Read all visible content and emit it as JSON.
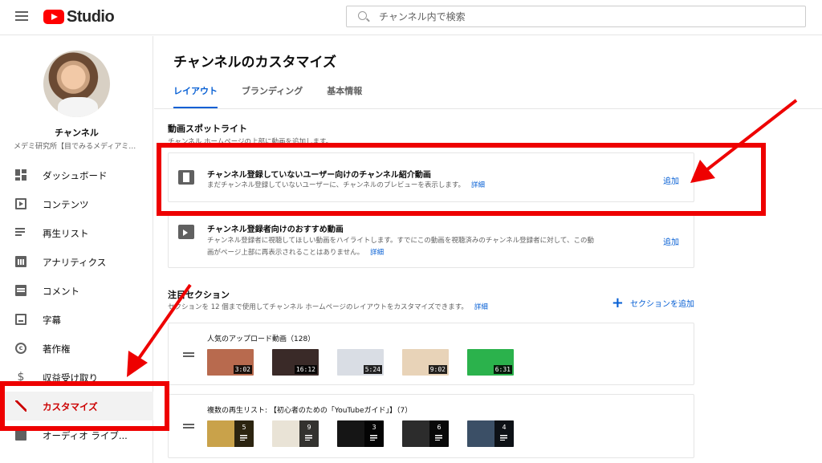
{
  "topbar": {
    "logo_text": "Studio",
    "search_placeholder": "チャンネル内で検索"
  },
  "sidebar": {
    "channel_title": "チャンネル",
    "channel_name": "メデミ研究所【目でみるメディアミックス】",
    "items": [
      {
        "label": "ダッシュボード",
        "icon": "dashboard-icon"
      },
      {
        "label": "コンテンツ",
        "icon": "video-library-icon"
      },
      {
        "label": "再生リスト",
        "icon": "playlist-icon"
      },
      {
        "label": "アナリティクス",
        "icon": "analytics-icon"
      },
      {
        "label": "コメント",
        "icon": "comment-icon"
      },
      {
        "label": "字幕",
        "icon": "subtitles-icon"
      },
      {
        "label": "著作権",
        "icon": "copyright-icon"
      },
      {
        "label": "収益受け取り",
        "icon": "dollar-icon"
      },
      {
        "label": "カスタマイズ",
        "icon": "magic-wand-icon",
        "active": true
      },
      {
        "label": "オーディオ ライブ...",
        "icon": "audio-library-icon"
      }
    ]
  },
  "main": {
    "title": "チャンネルのカスタマイズ",
    "tabs": [
      {
        "label": "レイアウト",
        "active": true
      },
      {
        "label": "ブランディング"
      },
      {
        "label": "基本情報"
      }
    ],
    "spotlight": {
      "heading": "動画スポットライト",
      "description": "チャンネル ホームページの上部に動画を追加します。",
      "cards": [
        {
          "title": "チャンネル登録していないユーザー向けのチャンネル紹介動画",
          "description": "まだチャンネル登録していないユーザーに、チャンネルのプレビューを表示します。",
          "details_link": "詳細",
          "action": "追加"
        },
        {
          "title": "チャンネル登録者向けのおすすめ動画",
          "description_line1": "チャンネル登録者に視聴してほしい動画をハイライトします。すでにこの動画を視聴済みのチャンネル登録者に対して、この動",
          "description_line2": "画がページ上部に再表示されることはありません。",
          "details_link": "詳細",
          "action": "追加"
        }
      ]
    },
    "featured": {
      "heading": "注目セクション",
      "description": "セクションを 12 個まで使用してチャンネル ホームページのレイアウトをカスタマイズできます。",
      "details_link": "詳細",
      "add_section": "セクションを追加",
      "shelves": [
        {
          "title": "人気のアップロード動画（128）",
          "items": [
            {
              "duration": "3:02",
              "color": "#b86a4e"
            },
            {
              "duration": "16:12",
              "color": "#3a2a28"
            },
            {
              "duration": "5:24",
              "color": "#d9dde4"
            },
            {
              "duration": "9:02",
              "color": "#e8d3b8"
            },
            {
              "duration": "6:31",
              "color": "#2bb24c"
            }
          ]
        },
        {
          "title": "複数の再生リスト: 【初心者のための「YouTubeガイド」】（7）",
          "items": [
            {
              "count": "5",
              "color": "#c9a24a"
            },
            {
              "count": "9",
              "color": "#e9e3d6"
            },
            {
              "count": "3",
              "color": "#151515"
            },
            {
              "count": "6",
              "color": "#2c2c2c"
            },
            {
              "count": "4",
              "color": "#3b4f66"
            }
          ]
        }
      ]
    }
  },
  "colors": {
    "brand_red": "#ff0000",
    "link_blue": "#065fd4",
    "annotation_red": "#ee0000"
  }
}
